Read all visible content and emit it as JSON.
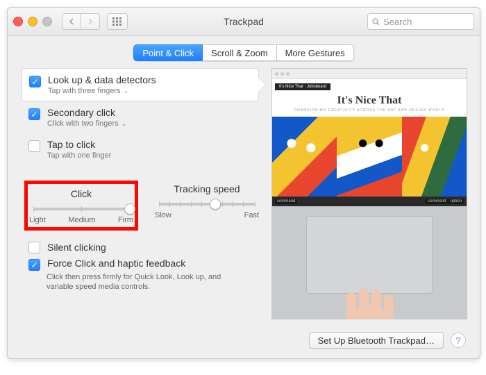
{
  "window": {
    "title": "Trackpad",
    "search_placeholder": "Search"
  },
  "tabs": [
    {
      "label": "Point & Click",
      "active": true
    },
    {
      "label": "Scroll & Zoom",
      "active": false
    },
    {
      "label": "More Gestures",
      "active": false
    }
  ],
  "options": {
    "lookup": {
      "title": "Look up & data detectors",
      "sub": "Tap with three fingers",
      "checked": true
    },
    "secondary": {
      "title": "Secondary click",
      "sub": "Click with two fingers",
      "checked": true
    },
    "tap": {
      "title": "Tap to click",
      "sub": "Tap with one finger",
      "checked": false
    }
  },
  "sliders": {
    "click": {
      "label": "Click",
      "ticks": [
        "Light",
        "Medium",
        "Firm"
      ],
      "pos": 2
    },
    "tracking": {
      "label": "Tracking speed",
      "ticks": [
        "Slow",
        "Fast"
      ],
      "pos": 0.58
    }
  },
  "bottom": {
    "silent": {
      "label": "Silent clicking",
      "checked": false
    },
    "force": {
      "label": "Force Click and haptic feedback",
      "checked": true,
      "hint": "Click then press firmly for Quick Look, Look up, and variable speed media controls."
    }
  },
  "footer": {
    "setup": "Set Up Bluetooth Trackpad…",
    "help": "?"
  },
  "preview": {
    "site_title": "It's Nice That",
    "site_sub": "CHAMPIONING CREATIVITY ACROSS THE ART AND DESIGN WORLD",
    "keys_left": "command",
    "keys_right1": "command",
    "keys_right2": "option"
  }
}
